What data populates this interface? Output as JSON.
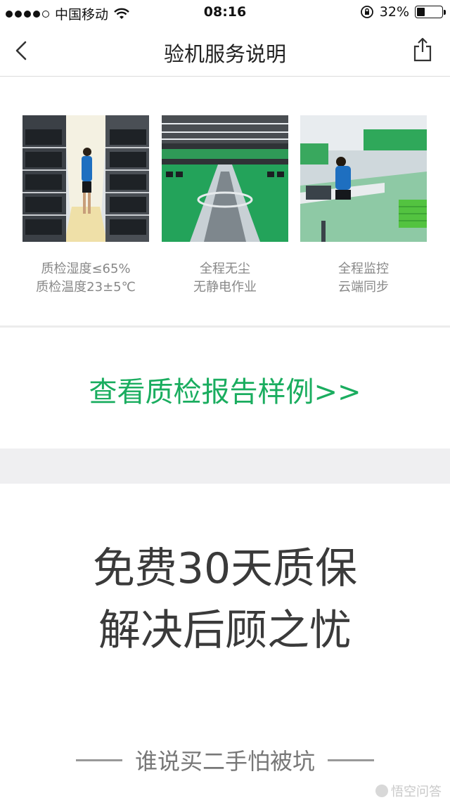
{
  "status_bar": {
    "carrier": "中国移动",
    "time": "08:16",
    "battery": "32%",
    "battery_level": 0.32
  },
  "nav": {
    "title": "验机服务说明"
  },
  "photos": [
    {
      "line1": "质检湿度≤65%",
      "line2": "质检温度23±5℃"
    },
    {
      "line1": "全程无尘",
      "line2": "无静电作业"
    },
    {
      "line1": "全程监控",
      "line2": "云端同步"
    }
  ],
  "report_link": "查看质检报告样例>>",
  "headline": {
    "line1": "免费30天质保",
    "line2": "解决后顾之忧"
  },
  "tagline": "谁说买二手怕被坑",
  "watermark": "悟空问答",
  "colors": {
    "accent": "#1aad5f",
    "divider": "#ececec",
    "band": "#efeff1"
  }
}
